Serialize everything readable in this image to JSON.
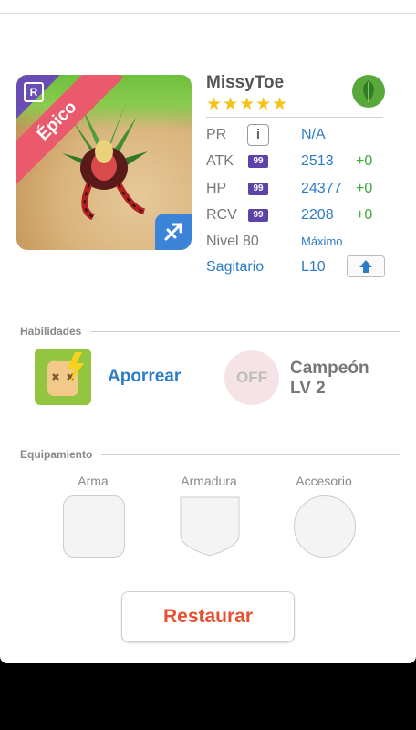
{
  "card": {
    "rarity_label": "Épico",
    "rarity_letter": "R"
  },
  "monster": {
    "name": "MissyToe",
    "stars": "★★★★★"
  },
  "stats": {
    "pr": {
      "label": "PR",
      "value": "N/A"
    },
    "atk": {
      "label": "ATK",
      "badge": "99",
      "value": "2513",
      "bonus": "+0"
    },
    "hp": {
      "label": "HP",
      "badge": "99",
      "value": "24377",
      "bonus": "+0"
    },
    "rcv": {
      "label": "RCV",
      "badge": "99",
      "value": "2208",
      "bonus": "+0"
    },
    "level": {
      "label": "Nivel 80",
      "value": "Máximo"
    },
    "sign": {
      "label": "Sagitario",
      "value": "L10"
    }
  },
  "skills": {
    "title": "Habilidades",
    "active_name": "Aporrear",
    "passive_state": "OFF",
    "passive_name_line1": "Campeón",
    "passive_name_line2": "LV 2"
  },
  "equipment": {
    "title": "Equipamiento",
    "weapon": "Arma",
    "armor": "Armadura",
    "accessory": "Accesorio"
  },
  "restore_label": "Restaurar",
  "colors": {
    "accent_blue": "#2d7cc7",
    "restore_orange": "#e8502e",
    "rarity_pink": "#ea5a6c",
    "badge_purple": "#5d43a8",
    "bonus_green": "#3aa83a"
  }
}
